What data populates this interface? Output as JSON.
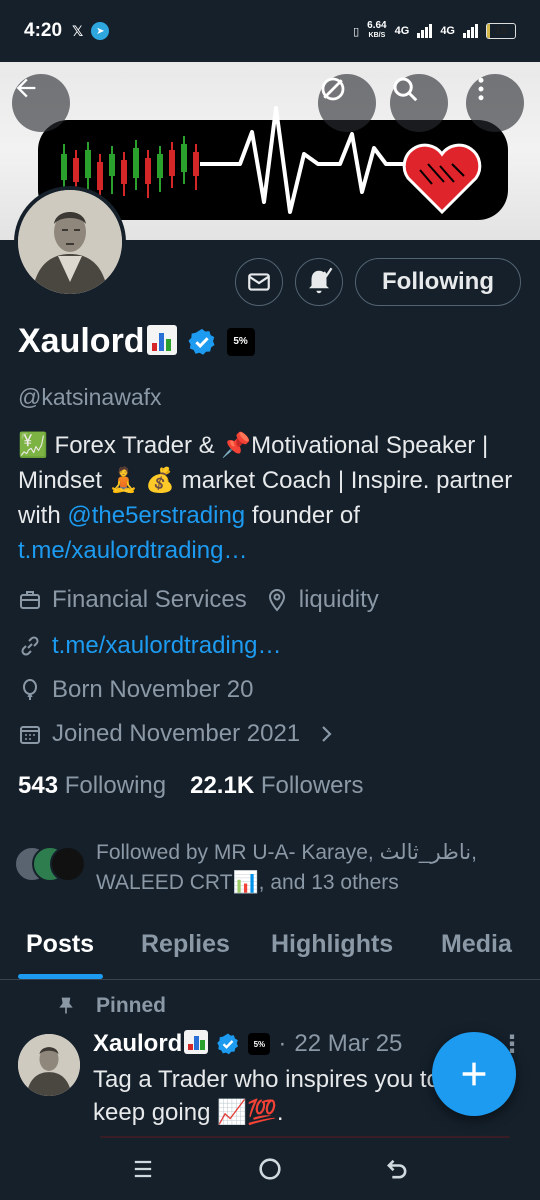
{
  "status_bar": {
    "time": "4:20",
    "x_app": "𝕏",
    "telegram_app": "➤",
    "net_speed_value": "6.64",
    "net_speed_unit": "KB/S",
    "network_1": "4G",
    "network_2": "4G",
    "battery": "10",
    "battery_level": 0.1
  },
  "profile": {
    "name": "Xaulord",
    "handle": "@katsinawafx",
    "badge_text": "5%",
    "bio": {
      "seg1": "💹 Forex Trader & 📌Motivational Speaker | Mindset 🧘 💰 market Coach | Inspire. partner with ",
      "mention": "@the5erstrading",
      "seg2": " founder of ",
      "link": "t.me/xaulordtrading…"
    },
    "category": "Financial Services",
    "location": "liquidity",
    "website": "t.me/xaulordtrading…",
    "born": "Born November 20",
    "joined": "Joined November 2021",
    "following_count": "543",
    "following_label": "Following",
    "followers_count": "22.1K",
    "followers_label": "Followers",
    "followed_by": "Followed by MR U-A- Karaye, ناظر_ثالث, WALEED CRT📊, and 13 others"
  },
  "actions": {
    "follow_state": "Following"
  },
  "tabs": [
    "Posts",
    "Replies",
    "Highlights",
    "Media"
  ],
  "active_tab": "Posts",
  "pinned_post": {
    "label": "Pinned",
    "author": "Xaulord",
    "separator": "·",
    "date": "22 Mar 25",
    "text": "Tag a Trader who inspires you to keep going 📈💯."
  },
  "colors": {
    "background": "#15202b",
    "accent": "#1d9bf0",
    "muted": "#8b98a5",
    "banner_heart": "#e0242c"
  },
  "icons": [
    "back-arrow-icon",
    "grok-icon",
    "search-icon",
    "more-icon",
    "mail-icon",
    "bell-icon",
    "briefcase-icon",
    "location-icon",
    "link-icon",
    "balloon-icon",
    "calendar-icon",
    "chevron-right-icon",
    "pin-icon",
    "verified-icon",
    "plus-icon",
    "recents-icon",
    "home-icon",
    "back-icon"
  ]
}
